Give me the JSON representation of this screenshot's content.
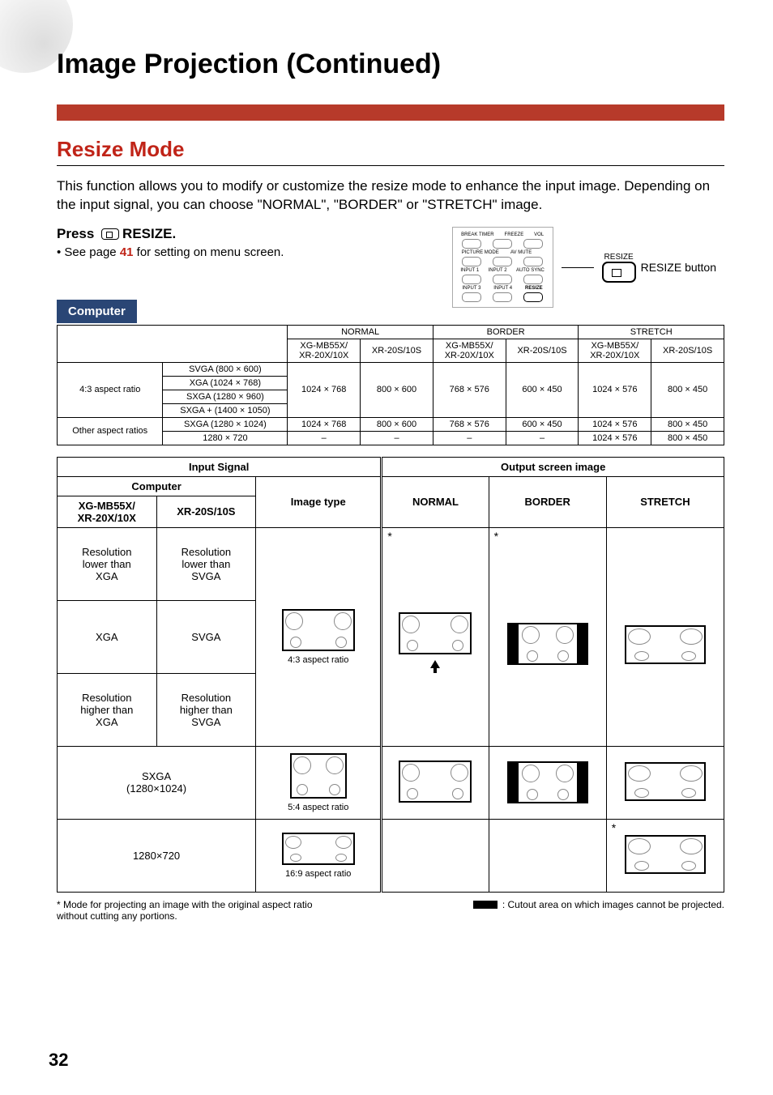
{
  "page_title": "Image Projection (Continued)",
  "section_title": "Resize Mode",
  "intro_text": "This function allows you to modify or customize the resize mode to enhance the input image. Depending on the input signal, you can choose \"NORMAL\", \"BORDER\" or \"STRETCH\" image.",
  "press_label_prefix": "Press ",
  "press_label_word": "RESIZE.",
  "sub_line_prefix": "• See page ",
  "sub_line_page": "41",
  "sub_line_suffix": " for setting on menu screen.",
  "resize_callout_small": "RESIZE",
  "resize_callout_text": "RESIZE button",
  "remote": {
    "row1": [
      "BREAK TIMER",
      "FREEZE",
      "VOL"
    ],
    "row2": [
      "PICTURE MODE",
      "AV MUTE",
      ""
    ],
    "row3": [
      "INPUT 1",
      "INPUT 2",
      "AUTO SYNC"
    ],
    "row4": [
      "INPUT 3",
      "INPUT 4",
      "RESIZE"
    ]
  },
  "computer_tab": "Computer",
  "table1": {
    "mode_headers": [
      "NORMAL",
      "BORDER",
      "STRETCH"
    ],
    "sub_headers": [
      "XG-MB55X/\nXR-20X/10X",
      "XR-20S/10S",
      "XG-MB55X/\nXR-20X/10X",
      "XR-20S/10S",
      "XG-MB55X/\nXR-20X/10X",
      "XR-20S/10S"
    ],
    "group1_label": "4:3 aspect ratio",
    "group1_rows": [
      "SVGA (800 × 600)",
      "XGA (1024 × 768)",
      "SXGA (1280 × 960)",
      "SXGA + (1400 × 1050)"
    ],
    "group1_vals": [
      "1024 × 768",
      "800 × 600",
      "768 × 576",
      "600 × 450",
      "1024 × 576",
      "800 × 450"
    ],
    "group2_label": "Other aspect ratios",
    "group2_row1": "SXGA (1280 × 1024)",
    "group2_row1_vals": [
      "1024 × 768",
      "800 × 600",
      "768 × 576",
      "600 × 450",
      "1024 × 576",
      "800 × 450"
    ],
    "group2_row2": "1280 × 720",
    "group2_row2_vals": [
      "–",
      "–",
      "–",
      "–",
      "1024 × 576",
      "800 × 450"
    ]
  },
  "table2": {
    "input_header": "Input Signal",
    "output_header": "Output screen image",
    "computer_header": "Computer",
    "col_models": [
      "XG-MB55X/\nXR-20X/10X",
      "XR-20S/10S"
    ],
    "col_imagetype": "Image type",
    "modes": [
      "NORMAL",
      "BORDER",
      "STRETCH"
    ],
    "rows": [
      {
        "a": "Resolution\nlower than\nXGA",
        "b": "Resolution\nlower than\nSVGA"
      },
      {
        "a": "XGA",
        "b": "SVGA"
      },
      {
        "a": "Resolution\nhigher than\nXGA",
        "b": "Resolution\nhigher than\nSVGA"
      }
    ],
    "aspect_labels": [
      "4:3 aspect ratio",
      "5:4 aspect ratio",
      "16:9 aspect ratio"
    ],
    "row4_label": "SXGA\n(1280×1024)",
    "row5_label": "1280×720"
  },
  "footnote_left": "* Mode for projecting an image with the original aspect ratio without cutting any portions.",
  "footnote_right": ": Cutout area on which images cannot be projected.",
  "page_number": "32",
  "asterisk": "*"
}
